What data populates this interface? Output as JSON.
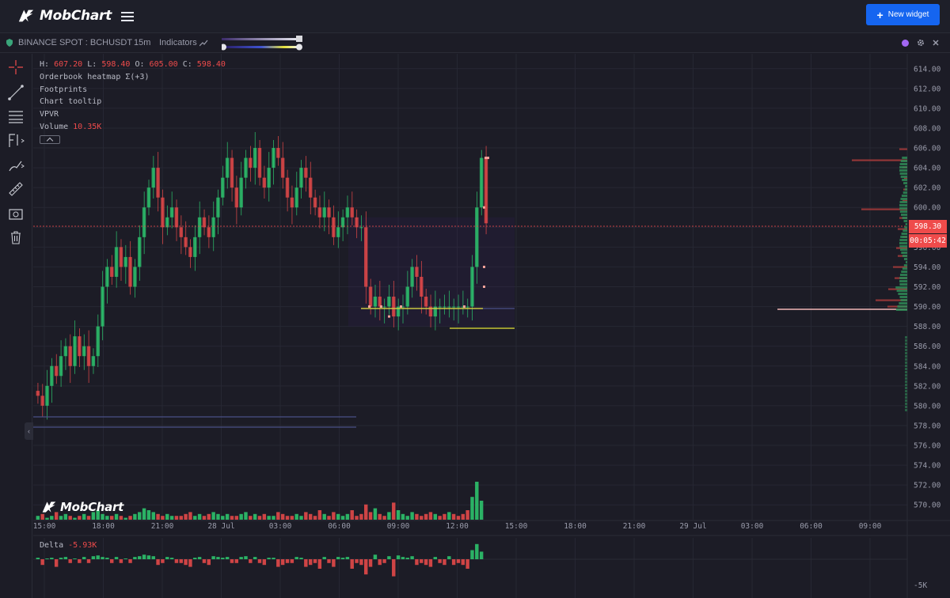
{
  "app": {
    "name": "MobChart",
    "new_widget_label": "New widget"
  },
  "chart_header": {
    "symbol": "BINANCE SPOT : BCHUSDT",
    "timeframe": "15m",
    "indicators_label": "Indicators"
  },
  "legend": {
    "ohlc": {
      "h_label": "H:",
      "h": "607.20",
      "l_label": "L:",
      "l": "598.40",
      "o_label": "O:",
      "o": "605.00",
      "c_label": "C:",
      "c": "598.40"
    },
    "items": [
      "Orderbook heatmap Σ(+3)",
      "Footprints",
      "Chart tooltip",
      "VPVR"
    ],
    "volume_label": "Volume",
    "volume_value": "10.35K"
  },
  "price_tag": {
    "price": "598.30",
    "countdown": "00:05:42"
  },
  "delta": {
    "label": "Delta",
    "value": "-5.93K",
    "axis_label": "-5K"
  },
  "colors": {
    "up": "#2ecc71",
    "down": "#ef4b4b",
    "accent": "#1565f0",
    "background": "#1c1c26"
  },
  "chart_data": {
    "type": "candlestick",
    "symbol": "BCHUSDT",
    "interval": "15m",
    "y_ticks": [
      614,
      612,
      610,
      608,
      606,
      604,
      602,
      600,
      598,
      596,
      594,
      592,
      590,
      588,
      586,
      584,
      582,
      580,
      578,
      576,
      574,
      572,
      570
    ],
    "y_tick_labels": [
      "614.00",
      "612.00",
      "610.00",
      "608.00",
      "606.00",
      "604.00",
      "602.00",
      "600.00",
      "598.00",
      "596.00",
      "594.00",
      "592.00",
      "590.00",
      "588.00",
      "586.00",
      "584.00",
      "582.00",
      "580.00",
      "578.00",
      "576.00",
      "574.00",
      "572.00",
      "570.00"
    ],
    "ylim": [
      568.5,
      615.5
    ],
    "x_tick_labels": [
      "15:00",
      "18:00",
      "21:00",
      "28 Jul",
      "03:00",
      "06:00",
      "09:00",
      "12:00",
      "15:00",
      "18:00",
      "21:00",
      "29 Jul",
      "03:00",
      "06:00",
      "09:00"
    ],
    "last_price": 598.3,
    "candles_close": [
      581,
      580,
      582,
      584,
      583,
      585,
      586,
      584,
      587,
      585,
      586,
      584,
      585,
      588,
      592,
      594,
      593,
      596,
      594,
      595,
      592,
      594,
      597,
      600,
      602,
      604,
      601,
      598,
      599,
      600,
      598,
      597,
      596,
      595,
      597,
      599,
      598,
      597,
      599,
      601,
      603,
      605,
      602,
      600,
      603,
      605,
      604,
      606,
      603,
      602,
      604,
      606,
      605,
      603,
      601,
      600,
      602,
      604,
      603,
      601,
      600,
      599,
      600,
      599,
      597,
      598,
      599,
      600,
      599,
      598,
      598,
      592,
      590,
      591,
      590,
      590,
      591,
      589,
      590,
      590,
      592,
      594,
      593,
      591,
      590,
      589,
      590,
      590,
      590,
      590,
      590,
      590,
      590,
      590,
      594,
      600,
      605,
      598.4
    ],
    "volume": [
      2,
      3,
      1,
      2,
      4,
      2,
      3,
      2,
      1,
      2,
      3,
      2,
      4,
      5,
      3,
      2,
      2,
      3,
      2,
      1,
      2,
      3,
      4,
      6,
      5,
      4,
      3,
      2,
      3,
      2,
      2,
      2,
      3,
      4,
      2,
      3,
      2,
      3,
      4,
      3,
      2,
      3,
      2,
      2,
      3,
      4,
      2,
      3,
      2,
      3,
      2,
      2,
      4,
      3,
      2,
      2,
      3,
      2,
      4,
      3,
      2,
      5,
      3,
      2,
      4,
      3,
      2,
      3,
      5,
      2,
      3,
      8,
      4,
      6,
      3,
      2,
      4,
      9,
      5,
      3,
      2,
      4,
      3,
      2,
      3,
      4,
      3,
      2,
      3,
      4,
      3,
      2,
      3,
      5,
      12,
      20,
      10
    ],
    "volume_up": [
      1,
      0,
      1,
      1,
      0,
      1,
      1,
      0,
      1,
      0,
      1,
      0,
      1,
      1,
      1,
      1,
      0,
      1,
      0,
      1,
      0,
      1,
      1,
      1,
      1,
      1,
      0,
      0,
      1,
      1,
      0,
      0,
      0,
      0,
      1,
      1,
      0,
      0,
      1,
      1,
      1,
      1,
      0,
      0,
      1,
      1,
      0,
      1,
      0,
      0,
      1,
      1,
      0,
      0,
      0,
      0,
      1,
      1,
      0,
      0,
      0,
      0,
      1,
      0,
      0,
      1,
      1,
      1,
      0,
      0,
      0,
      0,
      0,
      1,
      0,
      0,
      1,
      0,
      1,
      1,
      1,
      1,
      0,
      0,
      0,
      0,
      1,
      0,
      0,
      1,
      0,
      0,
      0,
      0,
      1,
      1,
      1,
      0
    ]
  }
}
